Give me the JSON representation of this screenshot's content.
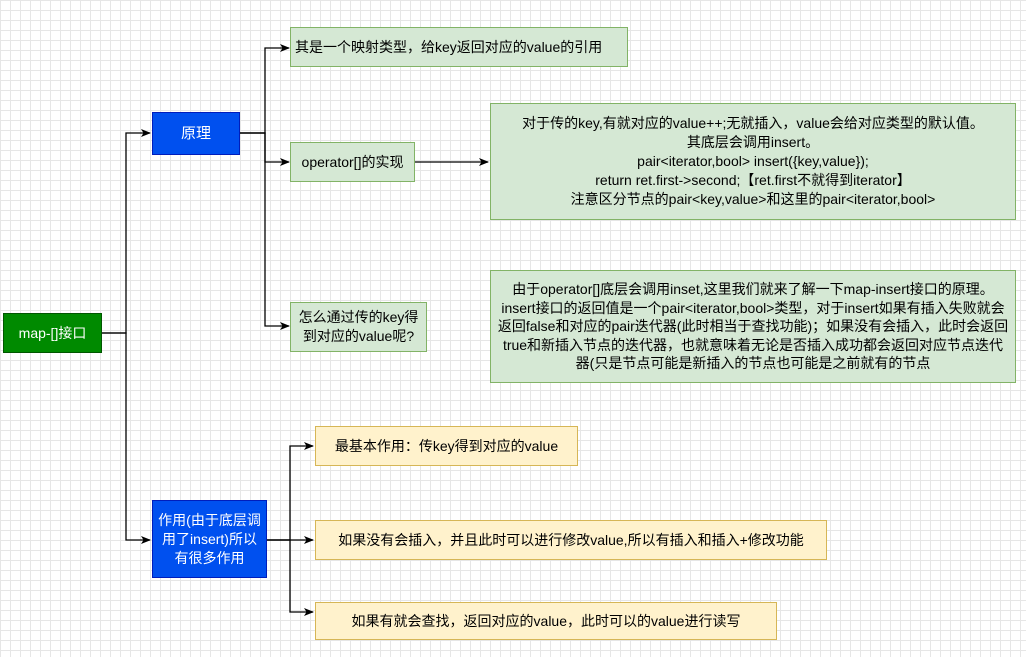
{
  "nodes": {
    "root": "map-[]接口",
    "principle": "原理",
    "purpose": "作用(由于底层调用了insert)所以有很多作用",
    "mapping": "其是一个映射类型，给key返回对应的value的引用",
    "operator_impl": "operator[]的实现",
    "how_get": "怎么通过传的key得到对应的value呢?",
    "detail_lines": [
      "对于传的key,有就对应的value++;无就插入，value会给对应类型的默认值。",
      "其底层会调用insert。",
      "pair<iterator,bool> insert({key,value});",
      "return  ret.first->second;【ret.first不就得到iterator】",
      "注意区分节点的pair<key,value>和这里的pair<iterator,bool>"
    ],
    "insert_explain": "由于operator[]底层会调用inset,这里我们就来了解一下map-insert接口的原理。insert接口的返回值是一个pair<iterator,bool>类型，对于insert如果有插入失败就会返回false和对应的pair迭代器(此时相当于查找功能)；如果没有会插入，此时会返回true和新插入节点的迭代器，也就意味着无论是否插入成功都会返回对应节点迭代器(只是节点可能是新插入的节点也可能是之前就有的节点",
    "use_basic": "最基本作用：传key得到对应的value",
    "use_insert": "如果没有会插入，并且此时可以进行修改value,所以有插入和插入+修改功能",
    "use_find": "如果有就会查找，返回对应的value，此时可以的value进行读写"
  },
  "colors": {
    "green_fill": "#d5e8d4",
    "green_stroke": "#82b366",
    "blue_fill": "#0050ef",
    "dark_green_fill": "#008a00",
    "yellow_fill": "#fff2cc",
    "yellow_stroke": "#d6b656",
    "edge": "#000000"
  }
}
